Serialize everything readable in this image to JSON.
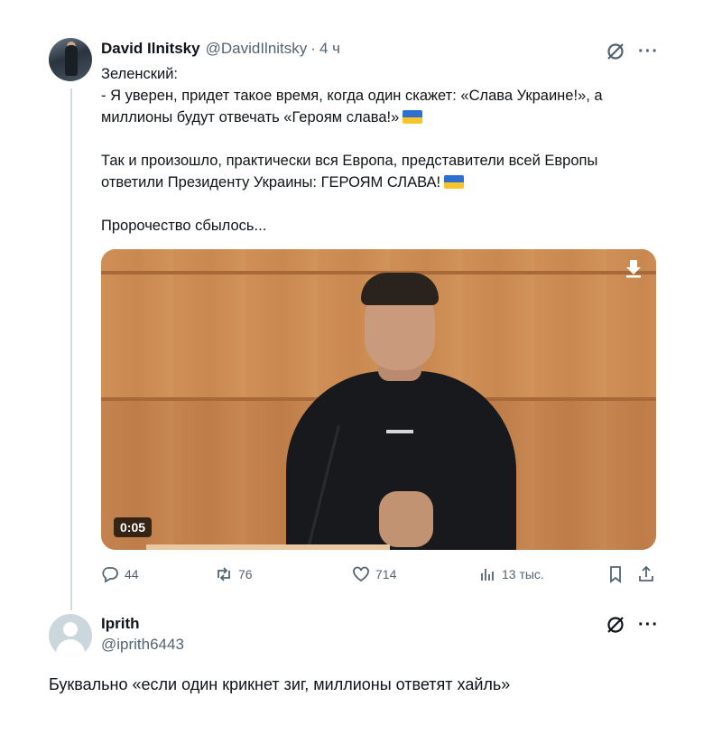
{
  "tweet": {
    "author_name": "David Ilnitsky",
    "author_handle": "@DavidIlnitsky",
    "separator": "·",
    "time": "4 ч",
    "more_label": "···",
    "text_line1": "Зеленский:",
    "text_line2": "- Я уверен, придет такое время, когда один скажет: «Слава Украине!», а",
    "text_line3": "миллионы будут отвечать «Героям слава!»",
    "text_line4": "Так и произошло, практически вся Европа, представители всей Европы",
    "text_line5": "ответили Президенту Украины: ГЕРОЯМ СЛАВА!",
    "text_line6": "Пророчество сбылось...",
    "flag_emoji": "ukraine-flag",
    "video": {
      "duration": "0:05",
      "download_icon": "download-icon"
    },
    "actions": {
      "replies": "44",
      "retweets": "76",
      "likes": "714",
      "views": "13 тыс."
    }
  },
  "reply": {
    "author_name": "Iprith",
    "author_handle": "@iprith6443",
    "more_label": "···",
    "text": "Буквально «если один крикнет зиг, миллионы ответят хайль»"
  },
  "colors": {
    "text_primary": "#0f1419",
    "text_secondary": "#536471",
    "thread_line": "#cfd9de",
    "flag_blue": "#2f6fd1",
    "flag_yellow": "#f7c52b"
  }
}
